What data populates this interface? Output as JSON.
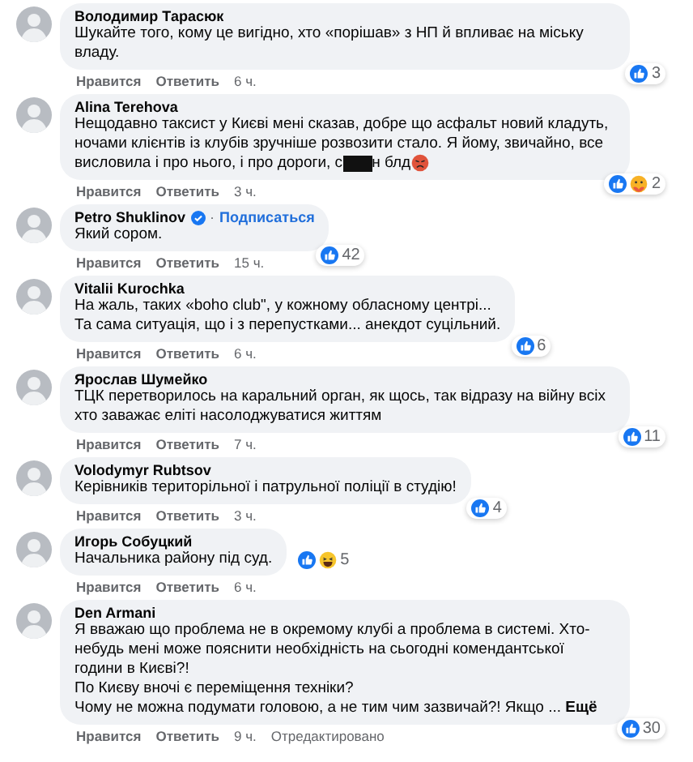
{
  "comments": [
    {
      "author": "Володимир Тарасюк",
      "lines": [
        "Шукайте того, кому це вигідно, хто «порішав» з НП й впливає на міську владу."
      ],
      "reactions": [
        {
          "kind": "like"
        }
      ],
      "reaction_count": "3",
      "actions": {
        "like": "Нравится",
        "reply": "Ответить",
        "time": "6 ч."
      }
    },
    {
      "author": "Alina Terehova",
      "lines": [
        "Нещодавно таксист у Києві мені сказав, добре що асфальт новий кладуть, ночами клієнтів із клубів зручніше розвозити стало. Я йому, звичайно, все висловила і про нього, і про дороги, с"
      ],
      "redacted_tail": "н блд",
      "emoji": {
        "kind": "angry"
      },
      "reactions": [
        {
          "kind": "like"
        },
        {
          "kind": "care"
        }
      ],
      "reaction_count": "2",
      "actions": {
        "like": "Нравится",
        "reply": "Ответить",
        "time": "3 ч."
      }
    },
    {
      "author": "Petro Shuklinov",
      "verified": true,
      "follow_separator": "·",
      "follow_link": "Подписаться",
      "lines": [
        "Який сором."
      ],
      "reactions": [
        {
          "kind": "like"
        }
      ],
      "reaction_count": "42",
      "actions": {
        "like": "Нравится",
        "reply": "Ответить",
        "time": "15 ч."
      }
    },
    {
      "author": "Vitalii Kurochka",
      "lines": [
        "На жаль, таких «boho club\", у кожному обласному центрі...",
        "Та сама ситуація, що і з перепустками... анекдот суцільний."
      ],
      "reactions": [
        {
          "kind": "like"
        }
      ],
      "reaction_count": "6",
      "actions": {
        "like": "Нравится",
        "reply": "Ответить",
        "time": "6 ч."
      }
    },
    {
      "author": "Ярослав Шумейко",
      "lines": [
        "ТЦК перетворилось на каральний орган, як щось, так відразу на війну всіх хто заважає еліті насолоджуватися життям"
      ],
      "reactions": [
        {
          "kind": "like"
        }
      ],
      "reaction_count": "11",
      "actions": {
        "like": "Нравится",
        "reply": "Ответить",
        "time": "7 ч."
      }
    },
    {
      "author": "Volodymyr Rubtsov",
      "lines": [
        "Керівників територільної і патрульної поліції в студію!"
      ],
      "reactions": [
        {
          "kind": "like"
        }
      ],
      "reaction_count": "4",
      "actions": {
        "like": "Нравится",
        "reply": "Ответить",
        "time": "3 ч."
      }
    },
    {
      "author": "Игорь Собуцкий",
      "lines": [
        "Начальника району під суд."
      ],
      "reactions": [
        {
          "kind": "like"
        },
        {
          "kind": "haha"
        }
      ],
      "reaction_count": "5",
      "inline_reactions": true,
      "actions": {
        "like": "Нравится",
        "reply": "Ответить",
        "time": "6 ч."
      }
    },
    {
      "author": "Den Armani",
      "lines": [
        "Я вважаю що проблема не в окремому клубі а проблема в системі. Хто-небудь мені може пояснити необхідність на сьогодні комендантської години в Києві?!",
        "По Києву вночі є переміщення техніки?",
        "Чому не можна подумати головою, а не тим чим зазвичай?! Якщо ..."
      ],
      "more_link": "Ещё",
      "reactions": [
        {
          "kind": "like"
        }
      ],
      "reaction_count": "30",
      "actions": {
        "like": "Нравится",
        "reply": "Ответить",
        "time": "9 ч.",
        "edited": "Отредактировано"
      }
    }
  ]
}
